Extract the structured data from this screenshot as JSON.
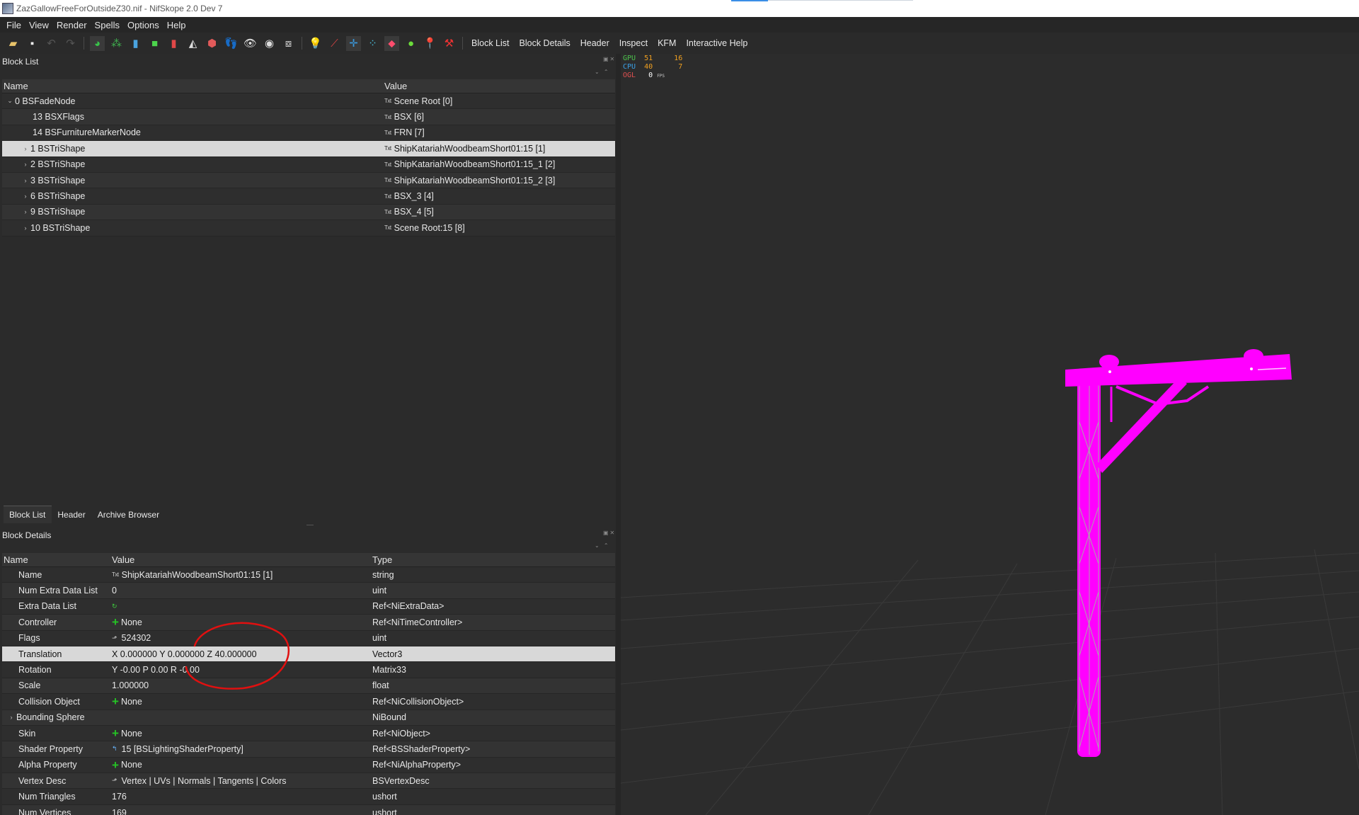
{
  "window": {
    "title": "ZazGallowFreeForOutsideZ30.nif - NifSkope 2.0 Dev 7"
  },
  "menu": [
    "File",
    "View",
    "Render",
    "Spells",
    "Options",
    "Help"
  ],
  "toolbar": {
    "links": [
      "Block List",
      "Block Details",
      "Header",
      "Inspect",
      "KFM",
      "Interactive Help"
    ]
  },
  "block_list": {
    "title": "Block List",
    "columns": {
      "name": "Name",
      "value": "Value"
    },
    "rows": [
      {
        "name": "0 BSFadeNode",
        "value": "Scene Root [0]"
      },
      {
        "name": "13 BSXFlags",
        "value": "BSX [6]"
      },
      {
        "name": "14 BSFurnitureMarkerNode",
        "value": "FRN [7]"
      },
      {
        "name": "1 BSTriShape",
        "value": "ShipKatariahWoodbeamShort01:15 [1]"
      },
      {
        "name": "2 BSTriShape",
        "value": "ShipKatariahWoodbeamShort01:15_1 [2]"
      },
      {
        "name": "3 BSTriShape",
        "value": "ShipKatariahWoodbeamShort01:15_2 [3]"
      },
      {
        "name": "6 BSTriShape",
        "value": "BSX_3 [4]"
      },
      {
        "name": "9 BSTriShape",
        "value": "BSX_4 [5]"
      },
      {
        "name": "10 BSTriShape",
        "value": "Scene Root:15 [8]"
      }
    ]
  },
  "lower_tabs": [
    "Block List",
    "Header",
    "Archive Browser"
  ],
  "block_details": {
    "title": "Block Details",
    "columns": {
      "name": "Name",
      "value": "Value",
      "type": "Type"
    },
    "rows": [
      {
        "name": "Name",
        "value": "ShipKatariahWoodbeamShort01:15 [1]",
        "type": "string"
      },
      {
        "name": "Num Extra Data List",
        "value": "0",
        "type": "uint"
      },
      {
        "name": "Extra Data List",
        "value": "",
        "type": "Ref<NiExtraData>"
      },
      {
        "name": "Controller",
        "value": "None",
        "type": "Ref<NiTimeController>"
      },
      {
        "name": "Flags",
        "value": "524302",
        "type": "uint"
      },
      {
        "name": "Translation",
        "value": "X 0.000000 Y 0.000000 Z 40.000000",
        "type": "Vector3"
      },
      {
        "name": "Rotation",
        "value": "Y -0.00 P 0.00 R -0.00",
        "type": "Matrix33"
      },
      {
        "name": "Scale",
        "value": "1.000000",
        "type": "float"
      },
      {
        "name": "Collision Object",
        "value": "None",
        "type": "Ref<NiCollisionObject>"
      },
      {
        "name": "Bounding Sphere",
        "value": "",
        "type": "NiBound"
      },
      {
        "name": "Skin",
        "value": "None",
        "type": "Ref<NiObject>"
      },
      {
        "name": "Shader Property",
        "value": "15 [BSLightingShaderProperty]",
        "type": "Ref<BSShaderProperty>"
      },
      {
        "name": "Alpha Property",
        "value": "None",
        "type": "Ref<NiAlphaProperty>"
      },
      {
        "name": "Vertex Desc",
        "value": "Vertex | UVs | Normals | Tangents | Colors",
        "type": "BSVertexDesc"
      },
      {
        "name": "Num Triangles",
        "value": "176",
        "type": "ushort"
      },
      {
        "name": "Num Vertices",
        "value": "169",
        "type": "ushort"
      }
    ]
  },
  "stats": {
    "gpu_label": "GPU",
    "gpu_val": "51",
    "gpu_val2": "16",
    "cpu_label": "CPU",
    "cpu_val": "40",
    "cpu_val2": "7",
    "ogl_label": "OGL",
    "ogl_val": "0",
    "fps_unit": "FPS"
  },
  "colors": {
    "mesh": "#ff00ff",
    "wire": "#7cff7c",
    "annotation": "#e01010",
    "selected_row": "#d8d8d8"
  }
}
